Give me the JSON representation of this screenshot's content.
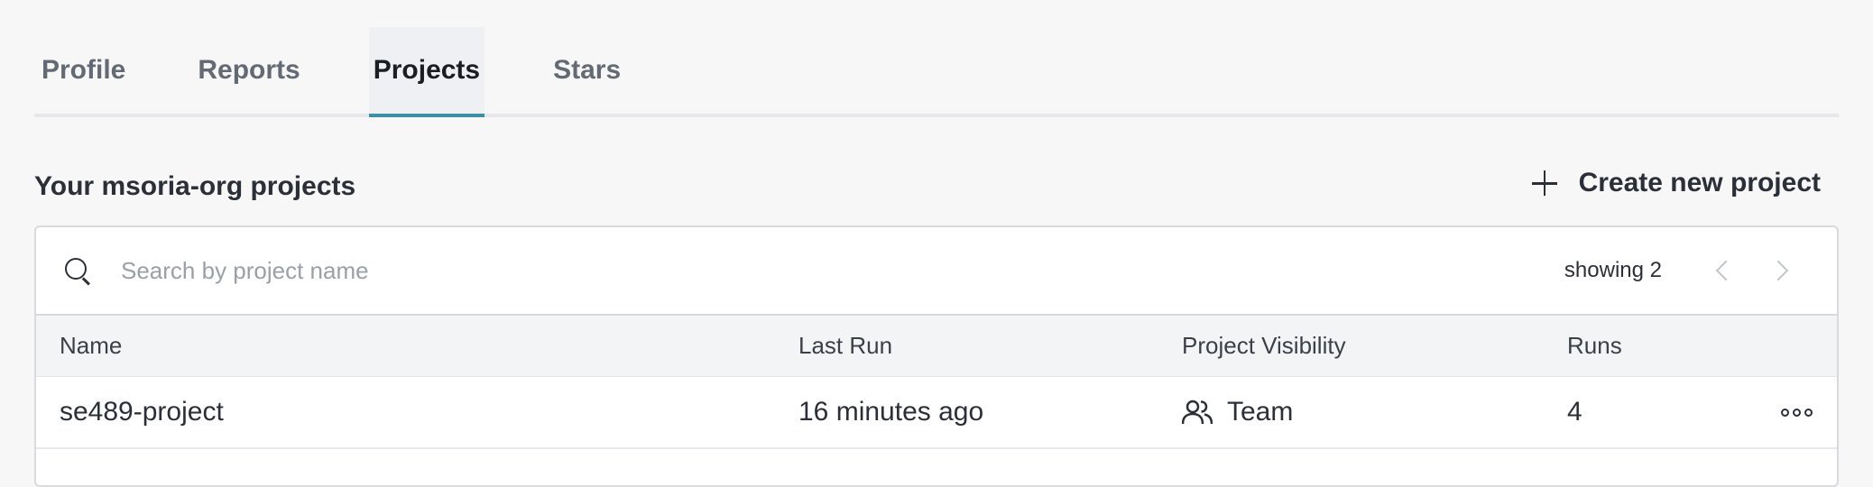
{
  "tabs": [
    {
      "label": "Profile",
      "active": false
    },
    {
      "label": "Reports",
      "active": false
    },
    {
      "label": "Projects",
      "active": true
    },
    {
      "label": "Stars",
      "active": false
    }
  ],
  "section": {
    "title": "Your msoria-org projects",
    "create_label": "Create new project"
  },
  "search": {
    "placeholder": "Search by project name",
    "value": "",
    "showing": "showing 2"
  },
  "table": {
    "columns": [
      "Name",
      "Last Run",
      "Project Visibility",
      "Runs"
    ],
    "rows": [
      {
        "name": "se489-project",
        "last_run": "16 minutes ago",
        "visibility": "Team",
        "runs": "4"
      }
    ]
  },
  "colors": {
    "accent": "#3e8ea8",
    "background": "#f7f7f8"
  },
  "icons": {
    "create": "plus-icon",
    "search": "search-icon",
    "visibility": "team-icon",
    "menu": "more-icon"
  }
}
